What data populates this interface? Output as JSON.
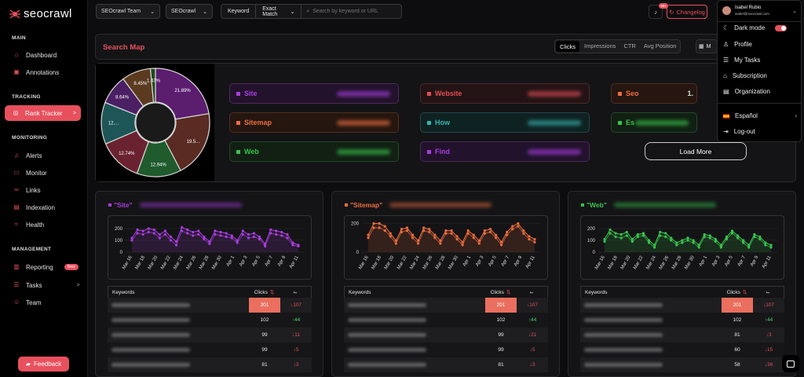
{
  "brand": {
    "name": "seocrawl"
  },
  "sidebar": {
    "sections": {
      "main": "MAIN",
      "tracking": "TRACKING",
      "monitoring": "MONITORING",
      "management": "MANAGEMENT"
    },
    "items": {
      "dashboard": "Dashboard",
      "annotations": "Annotations",
      "rank_tracker": "Rank Tracker",
      "alerts": "Alerts",
      "monitor": "Monitor",
      "links": "Links",
      "indexation": "Indexation",
      "health": "Health",
      "reporting": "Reporting",
      "reporting_badge": "New",
      "tasks": "Tasks",
      "team": "Team"
    },
    "feedback": "Feedback"
  },
  "topbar": {
    "team": "SEOcrawl Team",
    "project": "SEOcrawl",
    "search_type": "Keyword",
    "match_type": "Exact Match",
    "search_placeholder": "Search by keyword or URL",
    "notifications": "99+",
    "changelog": "Changelog"
  },
  "user": {
    "name": "Isabel Rubio",
    "email": "isabel@seocrawl.com"
  },
  "user_menu": {
    "dark_mode": "Dark mode",
    "profile": "Profile",
    "my_tasks": "My Tasks",
    "subscription": "Subscription",
    "organization": "Organization",
    "language": "Español",
    "logout": "Log-out"
  },
  "search_map": {
    "title": "Search Map",
    "tabs": [
      "Clicks",
      "Impressions",
      "CTR",
      "Avg Position"
    ],
    "active_tab": "Clicks",
    "date_prefix": "M",
    "load_more": "Load More",
    "pie": [
      {
        "label": "21.89%",
        "value": 21.89,
        "color": "#5b1d6e"
      },
      {
        "label": "19.5...",
        "value": 19.5,
        "color": "#5a2b22"
      },
      {
        "label": "12.94%",
        "value": 12.94,
        "color": "#1f5b2c"
      },
      {
        "label": "12.74%",
        "value": 12.74,
        "color": "#6b2230"
      },
      {
        "label": "12....",
        "value": 12.2,
        "color": "#1e5657"
      },
      {
        "label": "8.64%",
        "value": 8.64,
        "color": "#4b1f64"
      },
      {
        "label": "8.45%",
        "value": 8.45,
        "color": "#5b3a20"
      },
      {
        "label": "1.47%",
        "value": 1.47,
        "color": "#1f4a1f"
      }
    ],
    "keywords": [
      {
        "name": "Site",
        "color": "#a93ce0",
        "bg": "#22122c",
        "border": "#4a2a5c"
      },
      {
        "name": "Website",
        "color": "#e04e56",
        "bg": "#241315",
        "border": "#4a2a2c"
      },
      {
        "name": "Seo",
        "color": "#ee6d3e",
        "bg": "#25160f",
        "border": "#4e3020",
        "value": "1."
      },
      {
        "name": "Sitemap",
        "color": "#ee6d3e",
        "bg": "#25160f",
        "border": "#4e3020"
      },
      {
        "name": "How",
        "color": "#33b5b0",
        "bg": "#0f2222",
        "border": "#24454a"
      },
      {
        "name": "Es",
        "color": "#37c34c",
        "bg": "#112012",
        "border": "#24482a"
      },
      {
        "name": "Web",
        "color": "#37c34c",
        "bg": "#112012",
        "border": "#24482a"
      },
      {
        "name": "Find",
        "color": "#a93ce0",
        "bg": "#22122c",
        "border": "#4a2a5c"
      }
    ]
  },
  "dates": [
    "Mar 16",
    "Mar 18",
    "Mar 20",
    "Mar 22",
    "Mar 24",
    "Mar 26",
    "Mar 28",
    "Mar 30",
    "Apr 1",
    "Apr 3",
    "Apr 5",
    "Apr 7",
    "Apr 9",
    "Apr 11"
  ],
  "cards": [
    {
      "title": "\"Site\"",
      "color": "#a93ce0",
      "yticks": [
        "200",
        "100",
        "0"
      ],
      "ymax": 280,
      "s1": [
        120,
        190,
        180,
        200,
        190,
        150,
        180,
        130,
        90,
        210,
        190,
        170,
        180,
        130,
        90,
        180,
        170,
        160,
        140,
        100,
        180,
        150,
        160,
        130,
        70,
        190,
        180,
        170,
        150,
        80,
        60
      ],
      "s2": [
        100,
        160,
        150,
        170,
        160,
        120,
        150,
        100,
        60,
        180,
        160,
        140,
        150,
        110,
        70,
        150,
        140,
        130,
        120,
        80,
        150,
        120,
        130,
        110,
        50,
        160,
        150,
        140,
        120,
        60,
        50
      ],
      "rows": [
        {
          "clicks": "201",
          "delta": "↓107",
          "up": false
        },
        {
          "clicks": "102",
          "delta": "↑44",
          "up": true
        },
        {
          "clicks": "99",
          "delta": "↓11",
          "up": false
        },
        {
          "clicks": "99",
          "delta": "↓5",
          "up": false
        },
        {
          "clicks": "81",
          "delta": "↓3",
          "up": false
        }
      ]
    },
    {
      "title": "\"Sitemap\"",
      "color": "#ee6d3e",
      "yticks": [
        "200",
        "0"
      ],
      "ymax": 230,
      "s1": [
        120,
        200,
        200,
        180,
        130,
        80,
        160,
        170,
        120,
        80,
        170,
        160,
        120,
        80,
        150,
        150,
        110,
        70,
        150,
        120,
        80,
        150,
        160,
        120,
        70,
        140,
        180,
        200,
        150,
        110,
        90
      ],
      "s2": [
        100,
        170,
        170,
        150,
        110,
        60,
        140,
        150,
        100,
        60,
        150,
        140,
        100,
        60,
        130,
        130,
        90,
        50,
        130,
        100,
        60,
        130,
        140,
        100,
        50,
        120,
        160,
        180,
        130,
        90,
        70
      ],
      "rows": [
        {
          "clicks": "201",
          "delta": "↓107",
          "up": false
        },
        {
          "clicks": "102",
          "delta": "↑44",
          "up": true
        },
        {
          "clicks": "99",
          "delta": "↓21",
          "up": false
        },
        {
          "clicks": "99",
          "delta": "↓5",
          "up": false
        },
        {
          "clicks": "81",
          "delta": "↓3",
          "up": false
        }
      ]
    },
    {
      "title": "\"Web\"",
      "color": "#37c34c",
      "yticks": [
        "200",
        "100",
        "0"
      ],
      "ymax": 280,
      "s1": [
        110,
        190,
        160,
        150,
        170,
        110,
        150,
        160,
        100,
        60,
        170,
        160,
        120,
        80,
        100,
        120,
        100,
        60,
        150,
        140,
        110,
        60,
        130,
        180,
        140,
        100,
        60,
        150,
        130,
        80,
        60
      ],
      "s2": [
        90,
        160,
        130,
        120,
        140,
        90,
        130,
        140,
        80,
        40,
        140,
        130,
        100,
        60,
        80,
        100,
        80,
        40,
        130,
        120,
        90,
        40,
        110,
        160,
        120,
        80,
        40,
        130,
        110,
        60,
        40
      ],
      "rows": [
        {
          "clicks": "201",
          "delta": "↓107",
          "up": false
        },
        {
          "clicks": "102",
          "delta": "↑44",
          "up": true
        },
        {
          "clicks": "81",
          "delta": "↓3",
          "up": false
        },
        {
          "clicks": "60",
          "delta": "↓15",
          "up": false
        },
        {
          "clicks": "58",
          "delta": "↓36",
          "up": false
        }
      ]
    }
  ],
  "table_labels": {
    "keywords": "Keywords",
    "clicks": "Clicks"
  }
}
